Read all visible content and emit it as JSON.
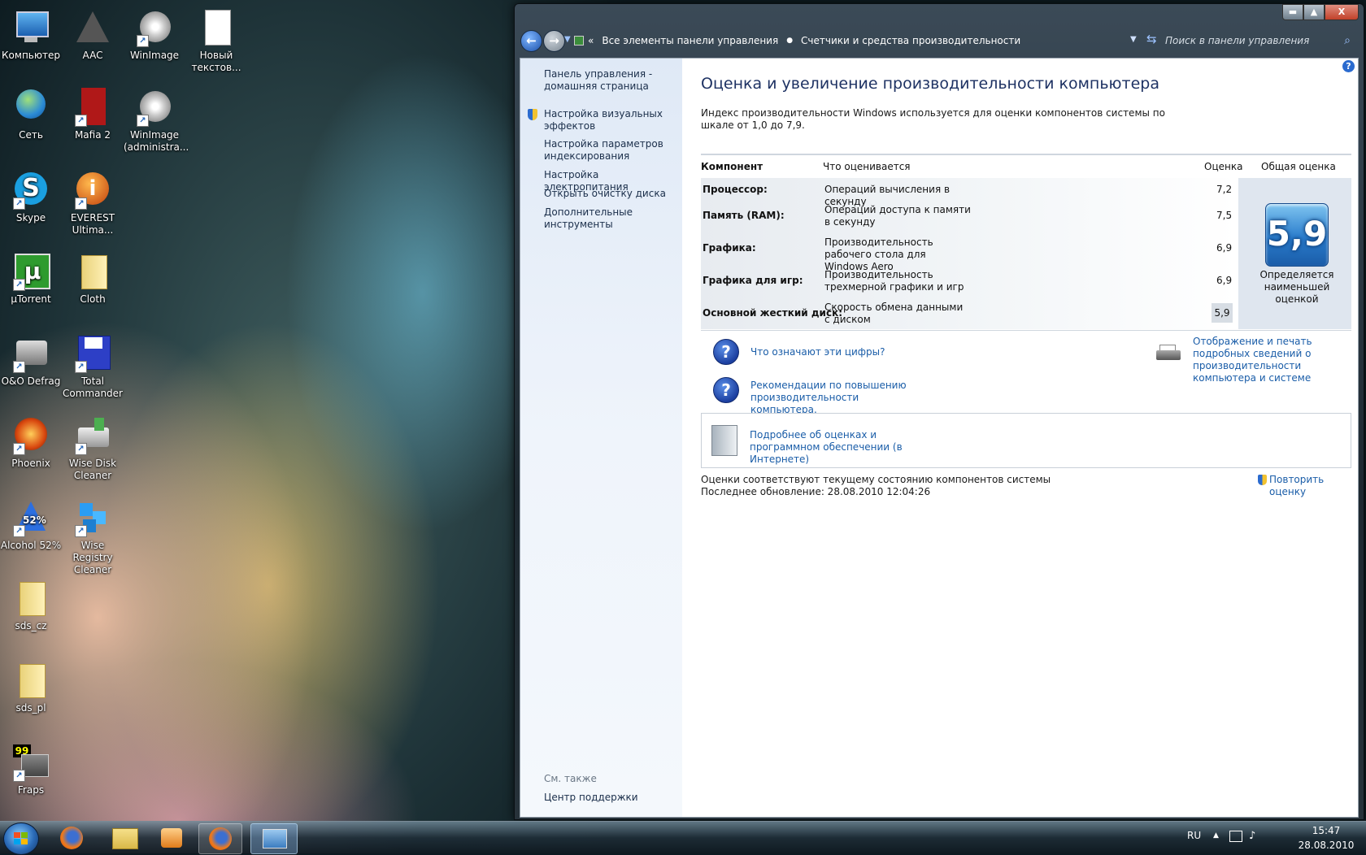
{
  "desktop": {
    "icons": [
      {
        "label": "Компьютер",
        "icon": "computer-icon"
      },
      {
        "label": "AAC",
        "icon": "aac-app-icon"
      },
      {
        "label": "WinImage",
        "icon": "winimage-icon"
      },
      {
        "label": "Новый текстов...",
        "icon": "text-document-icon"
      },
      {
        "label": "Сеть",
        "icon": "network-icon"
      },
      {
        "label": "Mafia 2",
        "icon": "mafia-game-icon"
      },
      {
        "label": "WinImage (administra...",
        "icon": "winimage-icon"
      },
      {
        "label": "Skype",
        "icon": "skype-icon"
      },
      {
        "label": "EVEREST Ultima...",
        "icon": "everest-icon"
      },
      {
        "label": "µTorrent",
        "icon": "utorrent-icon"
      },
      {
        "label": "Cloth",
        "icon": "folder-icon"
      },
      {
        "label": "O&O Defrag",
        "icon": "defrag-icon"
      },
      {
        "label": "Total Commander",
        "icon": "floppy-disk-icon"
      },
      {
        "label": "Phoenix",
        "icon": "phoenix-icon"
      },
      {
        "label": "Wise Disk Cleaner",
        "icon": "disk-cleaner-icon"
      },
      {
        "label": "Alcohol 52%",
        "icon": "alcohol-icon"
      },
      {
        "label": "Wise Registry Cleaner",
        "icon": "registry-cleaner-icon"
      },
      {
        "label": "sds_cz",
        "icon": "folder-icon"
      },
      {
        "label": "sds_pl",
        "icon": "folder-icon"
      },
      {
        "label": "Fraps",
        "icon": "fraps-icon"
      }
    ]
  },
  "window": {
    "controls": {
      "minimize": "▬",
      "maximize": "▲",
      "close": "X"
    },
    "breadcrumb": [
      "Все элементы панели управления",
      "Счетчики и средства производительности"
    ],
    "breadcrumb_prefix": "«",
    "search_placeholder": "Поиск в панели управления",
    "help": "?"
  },
  "sidebar": {
    "links": [
      "Панель управления - домашняя страница",
      "Настройка визуальных эффектов",
      "Настройка параметров индексирования",
      "Настройка электропитания",
      "Открыть очистку диска",
      "Дополнительные инструменты"
    ],
    "see_also_title": "См. также",
    "see_also_link": "Центр поддержки"
  },
  "main": {
    "title": "Оценка и увеличение производительности компьютера",
    "description": "Индекс производительности Windows используется для оценки компонентов системы по шкале от 1,0 до 7,9.",
    "columns": {
      "component": "Компонент",
      "rated": "Что оценивается",
      "score": "Оценка",
      "overall": "Общая оценка"
    },
    "rows": [
      {
        "component": "Процессор:",
        "rated": "Операций вычисления в секунду",
        "score": "7,2"
      },
      {
        "component": "Память (RAM):",
        "rated": "Операций доступа к памяти в секунду",
        "score": "7,5"
      },
      {
        "component": "Графика:",
        "rated": "Производительность рабочего стола для Windows Aero",
        "score": "6,9"
      },
      {
        "component": "Графика для игр:",
        "rated": "Производительность трехмерной графики и игр",
        "score": "6,9"
      },
      {
        "component": "Основной жесткий диск:",
        "rated": "Скорость обмена данными с диском",
        "score": "5,9"
      }
    ],
    "overall_score": "5,9",
    "overall_caption": "Определяется наименьшей оценкой",
    "link_numbers": "Что означают эти цифры?",
    "link_tips": "Рекомендации по повышению производительности компьютера.",
    "link_print": "Отображение и печать подробных сведений о производительности компьютера и системе",
    "link_online": "Подробнее об оценках и программном обеспечении (в Интернете)",
    "status_line1": "Оценки соответствуют текущему состоянию компонентов системы",
    "status_line2": "Последнее обновление: 28.08.2010 12:04:26",
    "rerun": "Повторить оценку"
  },
  "taskbar": {
    "items": [
      "firefox-icon",
      "explorer-icon",
      "media-player-icon",
      "firefox-icon",
      "control-panel-icon"
    ],
    "lang": "RU",
    "time": "15:47",
    "date": "28.08.2010"
  },
  "colors": {
    "link": "#1a5da8",
    "title": "#1e3263",
    "score_tile": "#2a7ccc"
  }
}
